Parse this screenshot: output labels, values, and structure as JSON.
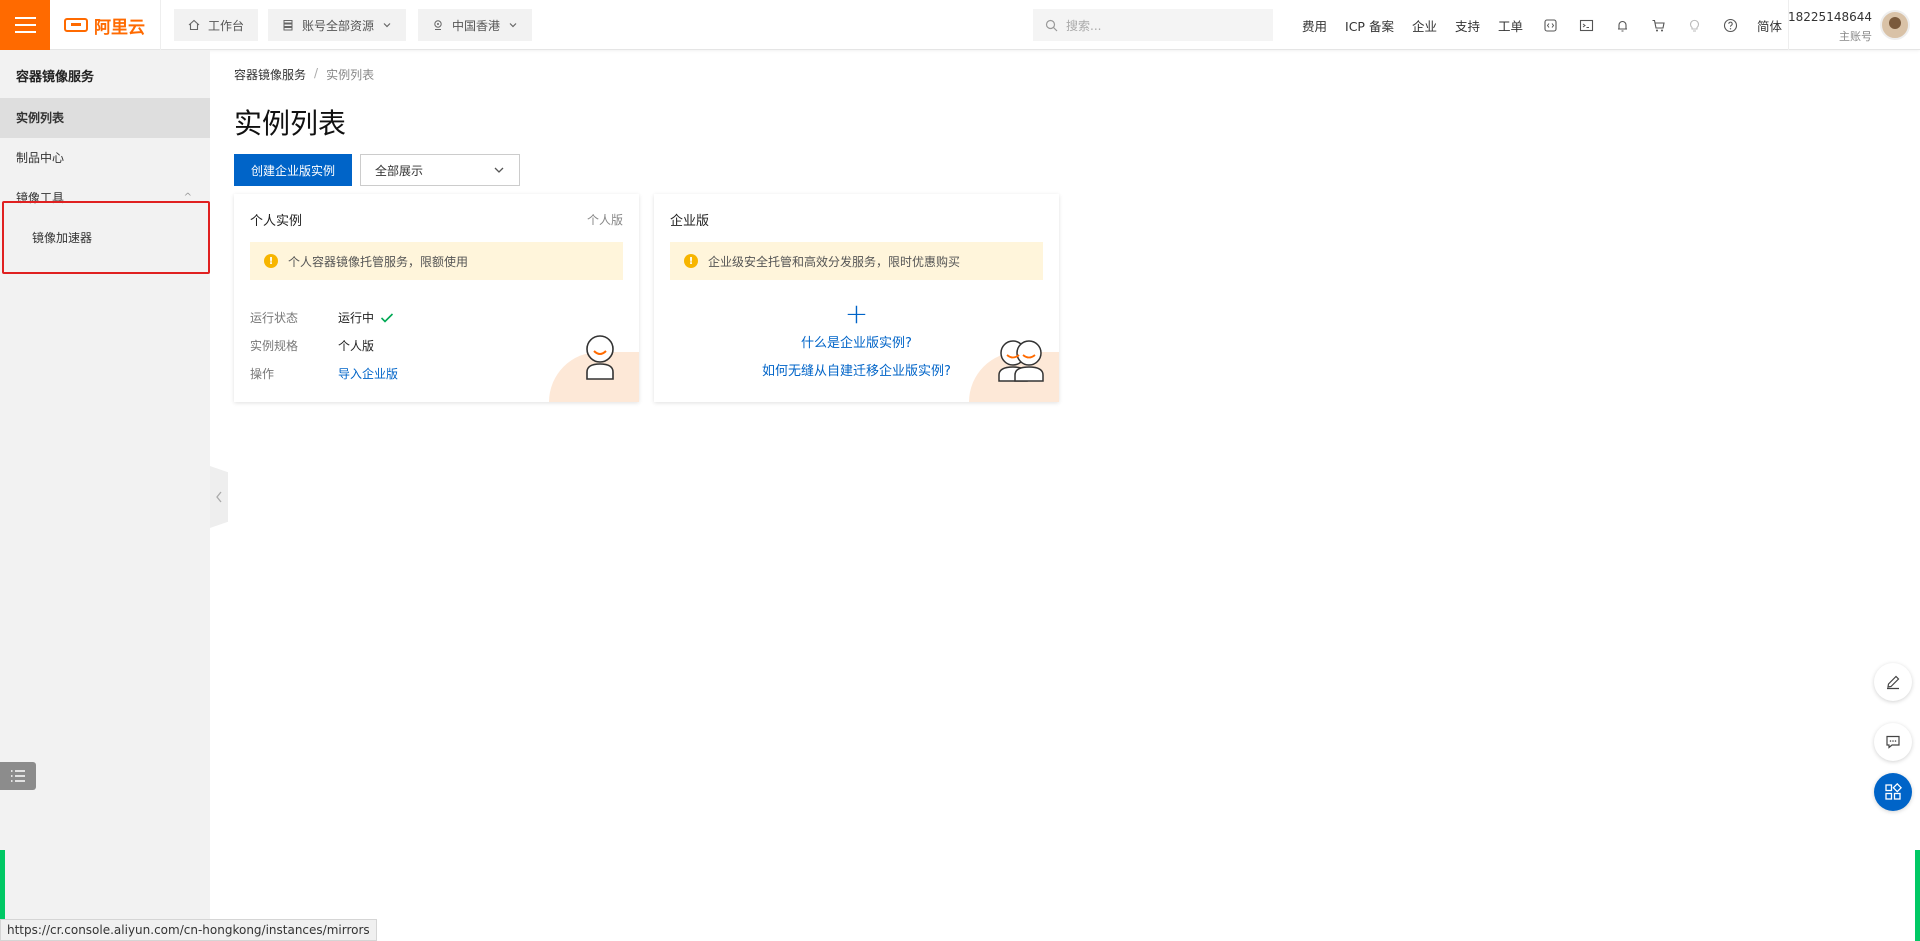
{
  "topbar": {
    "brand": "阿里云",
    "workbench": "工作台",
    "resources": "账号全部资源",
    "region": "中国香港",
    "search_placeholder": "搜索...",
    "links": [
      "费用",
      "ICP 备案",
      "企业",
      "支持",
      "工单"
    ],
    "lang": "简体",
    "user_phone": "18225148644",
    "user_role": "主账号"
  },
  "sidebar": {
    "title": "容器镜像服务",
    "items": [
      {
        "label": "实例列表",
        "active": true
      },
      {
        "label": "制品中心"
      },
      {
        "label": "镜像工具"
      },
      {
        "label": "镜像加速器"
      }
    ]
  },
  "main": {
    "breadcrumb": [
      "容器镜像服务",
      "实例列表"
    ],
    "title": "实例列表",
    "create_button": "创建企业版实例",
    "filter_value": "全部展示"
  },
  "personal_card": {
    "title": "个人实例",
    "tag": "个人版",
    "notice": "个人容器镜像托管服务，限额使用",
    "rows": [
      {
        "key": "运行状态",
        "value": "运行中"
      },
      {
        "key": "实例规格",
        "value": "个人版"
      },
      {
        "key": "操作",
        "value": "导入企业版"
      }
    ]
  },
  "enterprise_card": {
    "title": "企业版",
    "notice": "企业级安全托管和高效分发服务，限时优惠购买",
    "plus": "+",
    "link1": "什么是企业版实例?",
    "link2": "如何无缝从自建迁移企业版实例?"
  },
  "statusbar": {
    "url": "https://cr.console.aliyun.com/cn-hongkong/instances/mirrors"
  },
  "colors": {
    "brand": "#ff6a00",
    "primary": "#0064c8",
    "highlight_box": "#e02020",
    "notice_bg": "#fff5db",
    "success": "#00a854"
  }
}
